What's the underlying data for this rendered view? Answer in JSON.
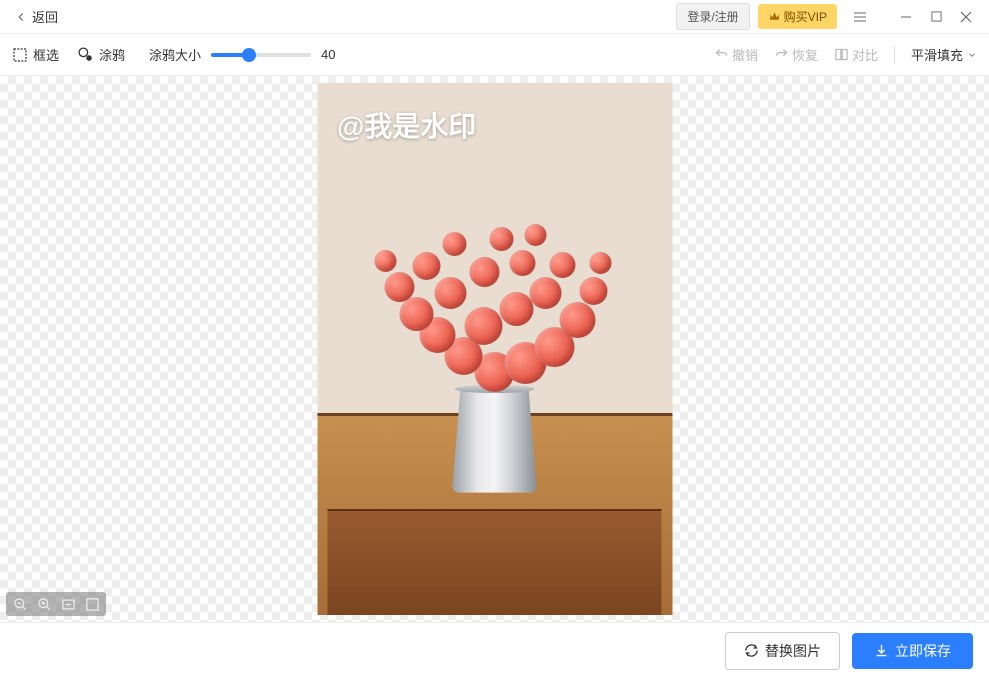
{
  "titlebar": {
    "back": "返回",
    "login": "登录/注册",
    "vip": "购买VIP"
  },
  "toolbar": {
    "box_select": "框选",
    "brush": "涂鸦",
    "size_label": "涂鸦大小",
    "size_value": "40",
    "undo": "撤销",
    "redo": "恢复",
    "compare": "对比",
    "fill_mode": "平滑填充"
  },
  "watermark": "@我是水印",
  "bottombar": {
    "replace": "替换图片",
    "save": "立即保存"
  }
}
